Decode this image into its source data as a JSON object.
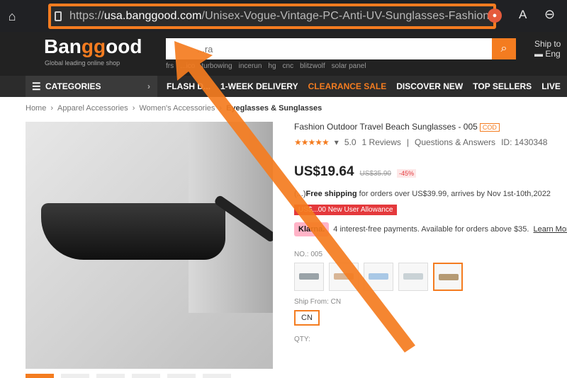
{
  "browser": {
    "url_prefix": "https://",
    "url_host": "usa.banggood.com",
    "url_path": "/Unisex-Vogue-Vintage-PC-Anti-UV-Sunglasses-Fashion-Out..."
  },
  "header": {
    "logo_a": "Ban",
    "logo_b": "gg",
    "logo_c": "ood",
    "tagline": "Global leading online shop",
    "search_placeholder": "...ra",
    "hot_words": [
      "frs",
      "...ico",
      "turbowing",
      "incerun",
      "hg",
      "cnc",
      "blitzwolf",
      "solar panel"
    ],
    "ship_to": "Ship to",
    "ship_lang": "Eng"
  },
  "nav": {
    "categories": "CATEGORIES",
    "links": [
      {
        "label": "FLASH D...",
        "hot": false
      },
      {
        "label": "1-WEEK DELIVERY",
        "hot": false
      },
      {
        "label": "CLEARANCE SALE",
        "hot": true
      },
      {
        "label": "DISCOVER NEW",
        "hot": false
      },
      {
        "label": "TOP SELLERS",
        "hot": false
      },
      {
        "label": "LIVE",
        "hot": false
      }
    ]
  },
  "breadcrumb": [
    "Home",
    "Apparel Accessories",
    "Women's Accessories",
    "Eyeglasses & Sunglasses"
  ],
  "product": {
    "title": "Fashion Outdoor Travel Beach Sunglasses - 005",
    "cod": "COD",
    "rating": "5.0",
    "reviews": "1 Reviews",
    "qa": "Questions & Answers",
    "id": "ID: 1430348",
    "price": "US$19.64",
    "old_price": "US$35.90",
    "discount": "-45%",
    "shipping_prefix": "(...)",
    "shipping_bold": "Free shipping",
    "shipping_rest": " for orders over US$39.99, arrives by Nov 1st-10th,2022",
    "allowance": "US$...00 New User Allowance",
    "klarna": "Klarna.",
    "klarna_text": "4 interest-free payments. Available for orders above $35.",
    "learn_more": "Learn More",
    "no_label": "NO.: 005",
    "ship_from_label": "Ship From: CN",
    "cn": "CN",
    "qty_label": "QTY:"
  },
  "colors": {
    "accent": "#f47c20",
    "swatches": [
      "#9aa3a8",
      "#d8b596",
      "#a9c8e6",
      "#c9d2d6",
      "#b59a73"
    ]
  }
}
